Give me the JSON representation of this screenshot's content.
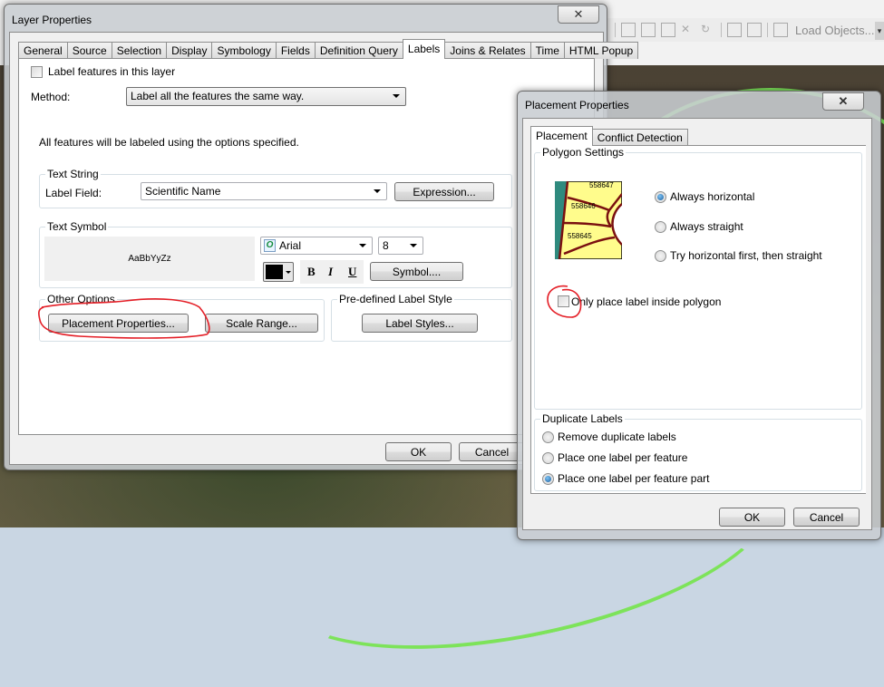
{
  "background": {
    "toolbar": {
      "load_objects_label": "Load Objects..."
    }
  },
  "layer_properties": {
    "title": "Layer Properties",
    "close_label": "✕",
    "tabs": [
      {
        "label": "General"
      },
      {
        "label": "Source"
      },
      {
        "label": "Selection"
      },
      {
        "label": "Display"
      },
      {
        "label": "Symbology"
      },
      {
        "label": "Fields"
      },
      {
        "label": "Definition Query"
      },
      {
        "label": "Labels",
        "active": true
      },
      {
        "label": "Joins & Relates"
      },
      {
        "label": "Time"
      },
      {
        "label": "HTML Popup"
      }
    ],
    "label_features_checkbox": {
      "label": "Label features in this layer",
      "checked": false
    },
    "method": {
      "label": "Method:",
      "value": "Label all the features the same way."
    },
    "info_text": "All features will be labeled using the options specified.",
    "text_string": {
      "legend": "Text String",
      "label_field_label": "Label Field:",
      "label_field_value": "Scientific Name",
      "expression_button": "Expression..."
    },
    "text_symbol": {
      "legend": "Text Symbol",
      "preview_text": "AaBbYyZz",
      "font_value": "Arial",
      "size_value": "8",
      "color": "#000000",
      "bold_label": "B",
      "italic_label": "I",
      "underline_label": "U",
      "symbol_button": "Symbol...."
    },
    "other_options": {
      "legend": "Other Options",
      "placement_button": "Placement Properties...",
      "scale_range_button": "Scale Range..."
    },
    "predefined_style": {
      "legend": "Pre-defined Label Style",
      "label_styles_button": "Label Styles..."
    },
    "ok_button": "OK",
    "cancel_button": "Cancel"
  },
  "placement_properties": {
    "title": "Placement Properties",
    "close_label": "✕",
    "tabs": [
      {
        "label": "Placement",
        "active": true
      },
      {
        "label": "Conflict Detection"
      }
    ],
    "polygon_settings": {
      "legend": "Polygon Settings",
      "preview_labels": [
        "558647",
        "558646",
        "558645"
      ],
      "options": [
        {
          "label": "Always horizontal",
          "checked": true
        },
        {
          "label": "Always straight",
          "checked": false
        },
        {
          "label": "Try horizontal first, then straight",
          "checked": false
        }
      ],
      "inside_polygon_checkbox": {
        "label": "Only place label inside polygon",
        "checked": false
      }
    },
    "duplicate_labels": {
      "legend": "Duplicate Labels",
      "options": [
        {
          "label": "Remove duplicate labels",
          "checked": false
        },
        {
          "label": "Place one label per feature",
          "checked": false
        },
        {
          "label": "Place one label per feature part",
          "checked": true
        }
      ]
    },
    "ok_button": "OK",
    "cancel_button": "Cancel"
  },
  "annotations": {
    "highlight_color": "#e41e26"
  }
}
